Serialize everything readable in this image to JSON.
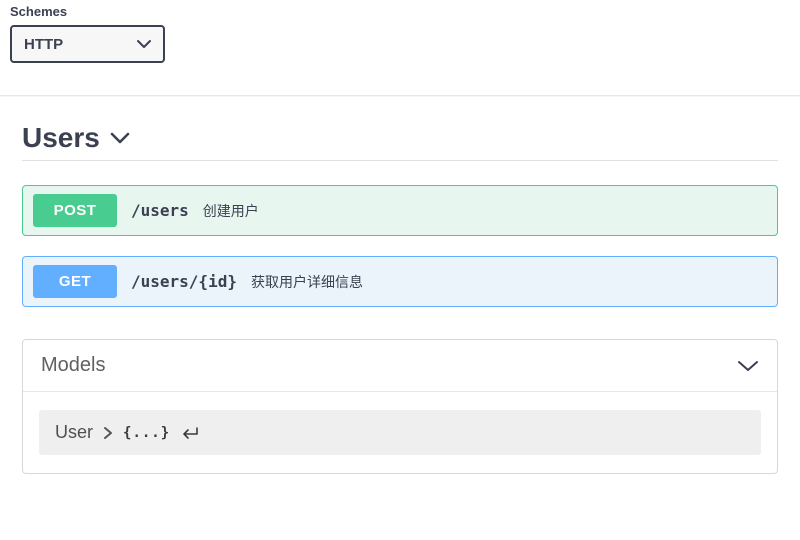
{
  "schemes": {
    "label": "Schemes",
    "selected": "HTTP"
  },
  "section": {
    "title": "Users"
  },
  "operations": [
    {
      "method": "POST",
      "methodClass": "post",
      "path": "/users",
      "summary": "创建用户"
    },
    {
      "method": "GET",
      "methodClass": "get",
      "path": "/users/{id}",
      "summary": "获取用户详细信息"
    }
  ],
  "models": {
    "heading": "Models",
    "items": [
      {
        "name": "User",
        "preview": "{...}"
      }
    ]
  }
}
